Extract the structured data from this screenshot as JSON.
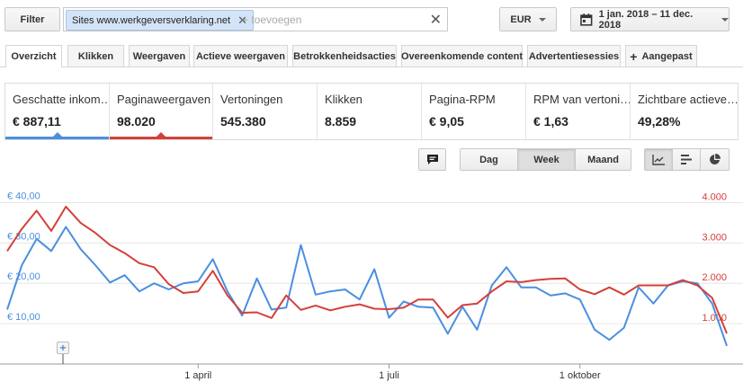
{
  "filter": {
    "label": "Filter",
    "chip": "Sites www.werkgeversverklaring.net",
    "placeholder": "+ toevoegen"
  },
  "currency": "EUR",
  "date_range": "1 jan. 2018 – 11 dec. 2018",
  "tabs": [
    {
      "label": "Overzicht",
      "active": true
    },
    {
      "label": "Klikken"
    },
    {
      "label": "Weergaven"
    },
    {
      "label": "Actieve weergaven"
    },
    {
      "label": "Betrokkenheidsacties"
    },
    {
      "label": "Overeenkomende content"
    },
    {
      "label": "Advertentiesessies"
    },
    {
      "label": "Aangepast",
      "prefix": "+"
    }
  ],
  "metrics": [
    {
      "label": "Geschatte inkom…",
      "value": "€ 887,11",
      "color": "#4a8fe0"
    },
    {
      "label": "Paginaweergaven",
      "value": "98.020",
      "color": "#d4403a"
    },
    {
      "label": "Vertoningen",
      "value": "545.380"
    },
    {
      "label": "Klikken",
      "value": "8.859"
    },
    {
      "label": "Pagina-RPM",
      "value": "€ 9,05"
    },
    {
      "label": "RPM van vertoni…",
      "value": "€ 1,63"
    },
    {
      "label": "Zichtbare actieve…",
      "value": "49,28%"
    }
  ],
  "granularity": {
    "options": [
      "Dag",
      "Week",
      "Maand"
    ],
    "selected": "Week"
  },
  "icons": [
    "comment-icon",
    "line-chart-icon",
    "bar-chart-icon",
    "pie-chart-icon",
    "calendar-icon",
    "close-icon",
    "plus-icon"
  ],
  "chart_data": {
    "type": "line",
    "x_tick_labels": [
      "1 april",
      "1 juli",
      "1 oktober"
    ],
    "x_tick_weeks": [
      13,
      26,
      39
    ],
    "weeks": 50,
    "left_axis": {
      "ticks": [
        10,
        20,
        30,
        40
      ],
      "labels": [
        "€ 10,00",
        "€ 20,00",
        "€ 30,00",
        "€ 40,00"
      ],
      "range": [
        0,
        45
      ],
      "color": "#4a8fe0"
    },
    "right_axis": {
      "ticks": [
        1000,
        2000,
        3000,
        4000
      ],
      "labels": [
        "1.000",
        "2.000",
        "3.000",
        "4.000"
      ],
      "range": [
        0,
        4500
      ],
      "color": "#d4403a"
    },
    "series": [
      {
        "axis": "left",
        "color": "#4a8fe0",
        "values": [
          13.5,
          24.5,
          31.0,
          28.0,
          34.0,
          28.5,
          24.5,
          20.2,
          22.0,
          18.0,
          20.0,
          18.5,
          20.0,
          20.5,
          26.0,
          18.0,
          12.0,
          21.2,
          13.5,
          14.0,
          29.5,
          17.2,
          18.0,
          18.5,
          16.0,
          23.5,
          11.5,
          15.5,
          14.2,
          14.0,
          7.5,
          14.2,
          8.5,
          19.5,
          24.0,
          19.0,
          19.0,
          17.0,
          17.5,
          16.0,
          8.5,
          6.0,
          9.0,
          19.0,
          15.0,
          19.5,
          20.5,
          20.0,
          15.0,
          4.5
        ]
      },
      {
        "axis": "right",
        "color": "#d4403a",
        "values": [
          2800,
          3350,
          3800,
          3300,
          3900,
          3500,
          3250,
          2950,
          2750,
          2500,
          2400,
          1980,
          1760,
          1800,
          2310,
          1700,
          1270,
          1280,
          1140,
          1700,
          1340,
          1450,
          1330,
          1420,
          1480,
          1370,
          1360,
          1400,
          1600,
          1600,
          1150,
          1460,
          1500,
          1800,
          2050,
          2030,
          2080,
          2110,
          2120,
          1850,
          1730,
          1900,
          1720,
          1950,
          1950,
          1950,
          2080,
          1950,
          1640,
          760
        ]
      }
    ]
  }
}
